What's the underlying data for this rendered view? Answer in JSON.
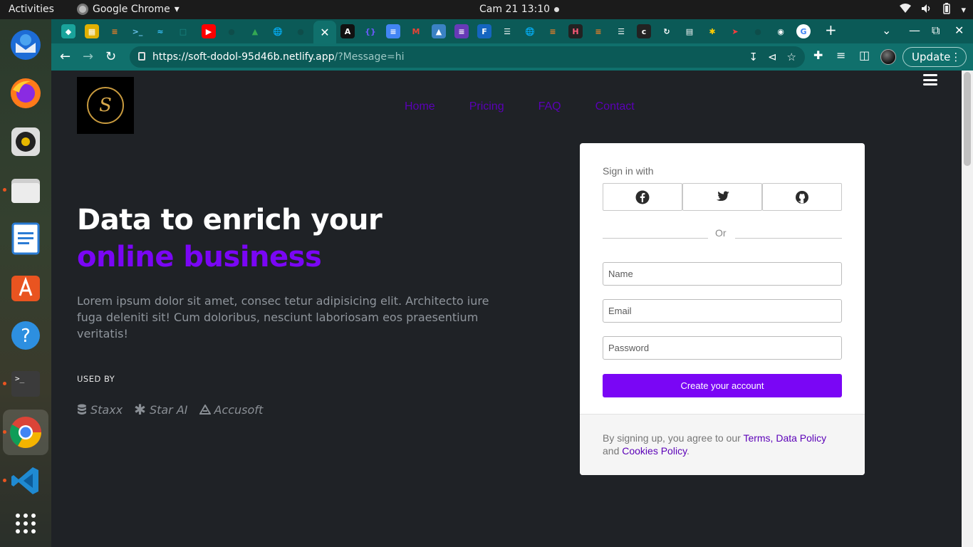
{
  "system": {
    "activities": "Activities",
    "app_name": "Google Chrome",
    "clock": "Cam 21  13:10"
  },
  "browser": {
    "url_main": "https://soft-dodol-95d46b.netlify.app",
    "url_query": "/?Message=hi",
    "update_label": "Update"
  },
  "page": {
    "nav": [
      "Home",
      "Pricing",
      "FAQ",
      "Contact"
    ],
    "hero": {
      "title_line1": "Data to enrich your",
      "title_line2": "online business",
      "description": "Lorem ipsum dolor sit amet, consec tetur adipisicing elit. Architecto iure fuga deleniti sit! Cum doloribus, nesciunt laboriosam eos praesentium veritatis!",
      "used_by_label": "USED BY",
      "brands": [
        "Staxx",
        "Star AI",
        "Accusoft"
      ]
    },
    "signup": {
      "sign_in_with": "Sign in with",
      "or": "Or",
      "name_placeholder": "Name",
      "email_placeholder": "Email",
      "password_placeholder": "Password",
      "submit_label": "Create your account",
      "terms_prefix": "By signing up, you agree to our ",
      "terms_link": "Terms, Data Policy",
      "terms_and": " and ",
      "cookies_link": "Cookies Policy",
      "terms_suffix": "."
    }
  },
  "colors": {
    "accent": "#7a06f5",
    "nav_link": "#5b00b8",
    "background": "#1f2226",
    "chrome_frame": "#10706c"
  }
}
